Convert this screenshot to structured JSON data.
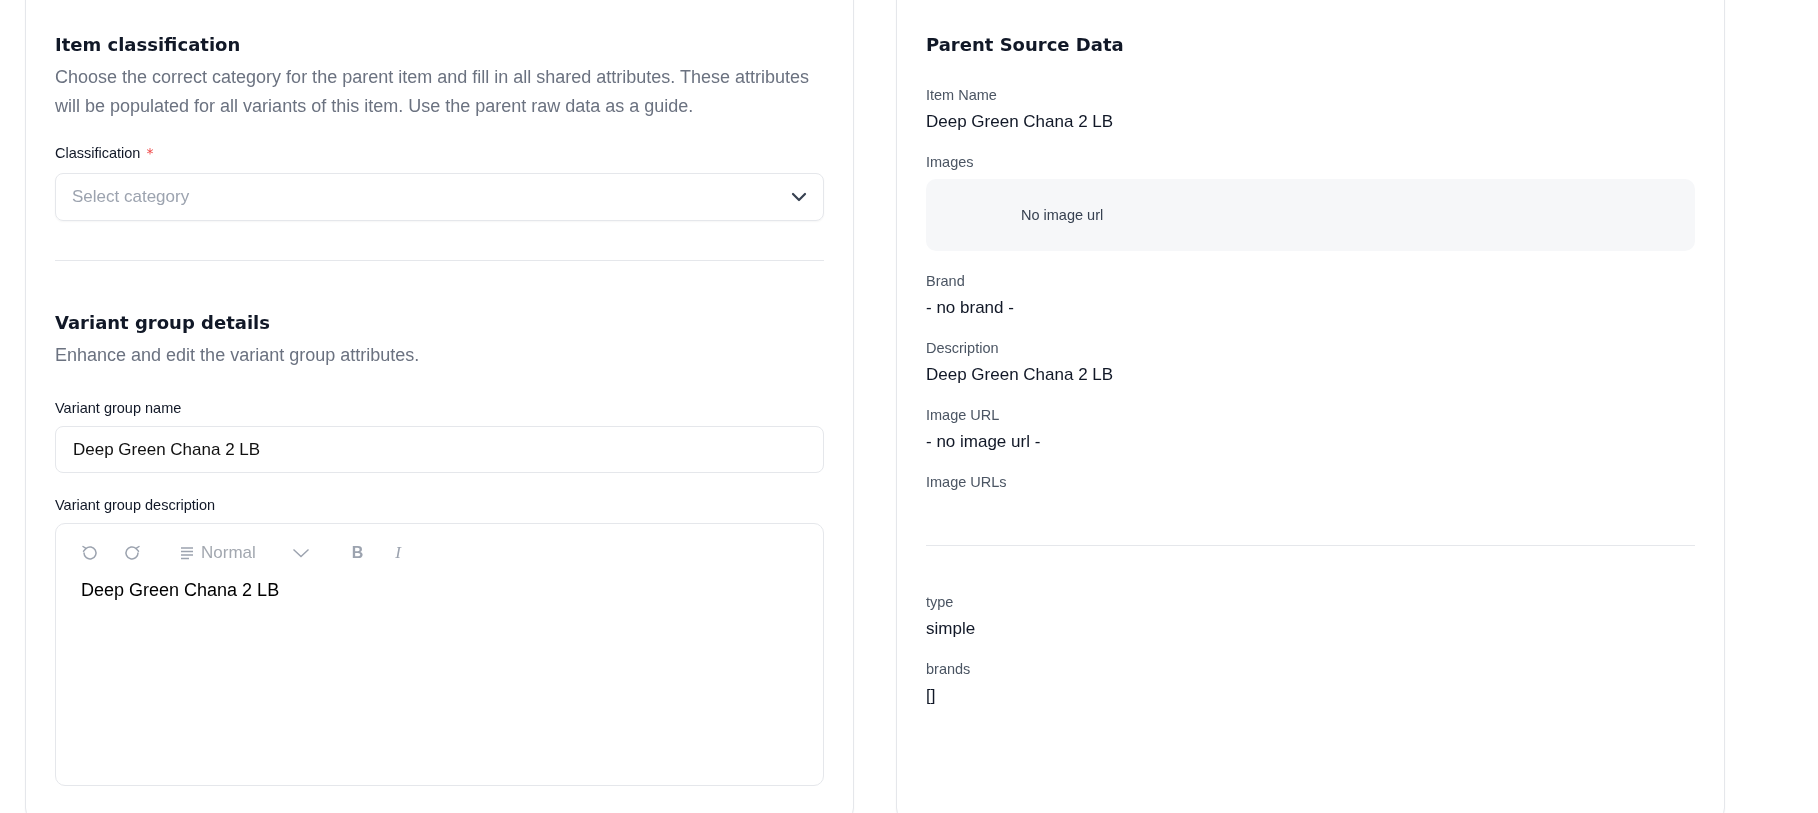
{
  "classification_section": {
    "title": "Item classification",
    "description": "Choose the correct category for the parent item and fill in all shared attributes. These attributes will be populated for all variants of this item. Use the parent raw data as a guide.",
    "field": {
      "label": "Classification",
      "required_mark": "*",
      "placeholder": "Select category"
    }
  },
  "variant_section": {
    "title": "Variant group details",
    "description": "Enhance and edit the variant group attributes.",
    "name_field": {
      "label": "Variant group name",
      "value": "Deep Green Chana 2 LB"
    },
    "description_field": {
      "label": "Variant group description",
      "toolbar": {
        "block_style": "Normal",
        "bold": "B",
        "italic": "I"
      },
      "value": "Deep Green Chana 2 LB"
    }
  },
  "parent_source": {
    "title": "Parent Source Data",
    "fields": [
      {
        "kind": "text",
        "label": "Item Name",
        "value": "Deep Green Chana 2 LB"
      },
      {
        "kind": "images",
        "label": "Images",
        "value": "No image url"
      },
      {
        "kind": "text",
        "label": "Brand",
        "value": "- no brand -"
      },
      {
        "kind": "text",
        "label": "Description",
        "value": "Deep Green Chana 2 LB"
      },
      {
        "kind": "text",
        "label": "Image URL",
        "value": "- no image url -"
      },
      {
        "kind": "text",
        "label": "Image URLs"
      }
    ],
    "extra_fields": [
      {
        "kind": "text",
        "label": "type",
        "value": "simple"
      },
      {
        "kind": "text",
        "label": "brands",
        "value": "[]"
      }
    ]
  }
}
